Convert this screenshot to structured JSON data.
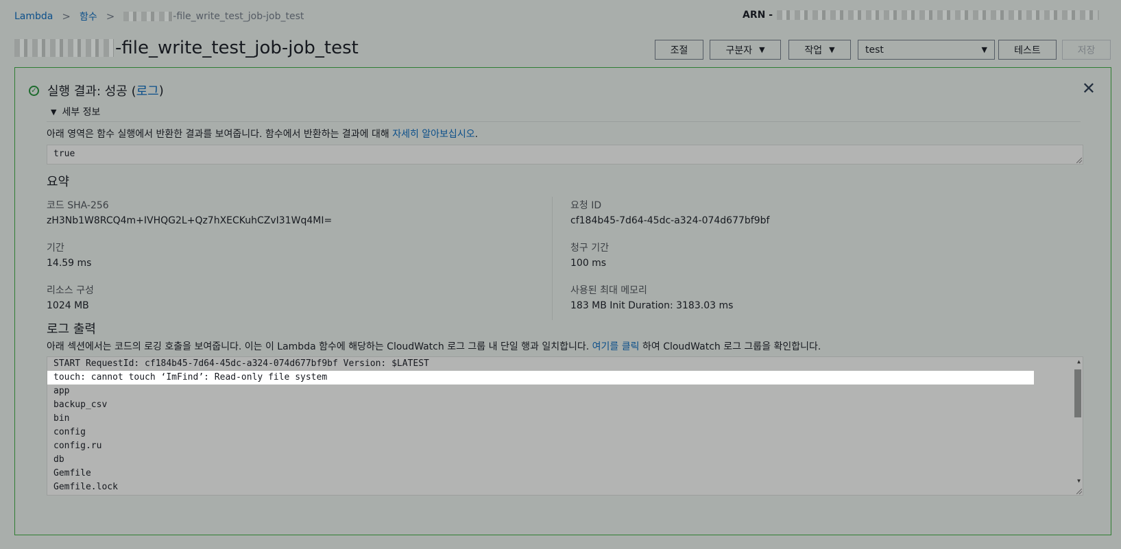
{
  "breadcrumb": {
    "root": "Lambda",
    "functions": "함수",
    "current_suffix": "-file_write_test_job-job_test"
  },
  "arn_label": "ARN -",
  "title_suffix": "-file_write_test_job-job_test",
  "toolbar": {
    "throttle": "조절",
    "qualifiers": "구분자",
    "actions": "작업",
    "test_event": "test",
    "test": "테스트",
    "save": "저장"
  },
  "result": {
    "status_prefix": "실행 결과: 성공 (",
    "log_link": "로그",
    "status_suffix": ")",
    "details_label": "세부 정보",
    "description_prefix": "아래 영역은 함수 실행에서 반환한 결과를 보여줍니다. 함수에서 반환하는 결과에 대해 ",
    "description_link": "자세히 알아보십시오",
    "description_suffix": ".",
    "return_value": "true"
  },
  "summary": {
    "title": "요약",
    "code_sha_label": "코드 SHA-256",
    "code_sha_value": "zH3Nb1W8RCQ4m+IVHQG2L+Qz7hXECKuhCZvI31Wq4MI=",
    "request_id_label": "요청 ID",
    "request_id_value": "cf184b45-7d64-45dc-a324-074d677bf9bf",
    "duration_label": "기간",
    "duration_value": "14.59 ms",
    "billed_label": "청구 기간",
    "billed_value": "100 ms",
    "resources_label": "리소스 구성",
    "resources_value": "1024 MB",
    "max_memory_label": "사용된 최대 메모리",
    "max_memory_value": "183 MB Init Duration: 3183.03 ms"
  },
  "log_output": {
    "title": "로그 출력",
    "description_prefix": "아래 섹션에서는 코드의 로깅 호출을 보여줍니다. 이는 이 Lambda 함수에 해당하는 CloudWatch 로그 그룹 내 단일 행과 일치합니다. ",
    "description_link": "여기를 클릭",
    "description_suffix": " 하여 CloudWatch 로그 그룹을 확인합니다.",
    "lines": [
      "START RequestId: cf184b45-7d64-45dc-a324-074d677bf9bf Version: $LATEST",
      "touch: cannot touch ‘ImFind’: Read-only file system",
      "app",
      "backup_csv",
      "bin",
      "config",
      "config.ru",
      "db",
      "Gemfile",
      "Gemfile.lock"
    ]
  }
}
